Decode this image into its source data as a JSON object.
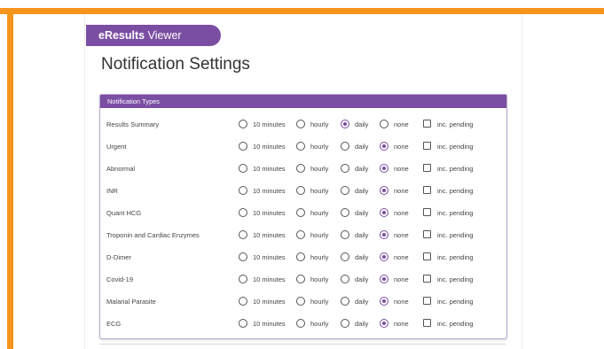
{
  "app": {
    "brand_bold": "eResults",
    "brand_rest": " Viewer"
  },
  "page": {
    "title": "Notification Settings"
  },
  "panel": {
    "header": "Notification Types"
  },
  "options": [
    "10 minutes",
    "hourly",
    "daily",
    "none"
  ],
  "pending_label": "inc. pending",
  "rows": [
    {
      "label": "Results Summary",
      "selected": "daily",
      "pending": false
    },
    {
      "label": "Urgent",
      "selected": "none",
      "pending": false
    },
    {
      "label": "Abnormal",
      "selected": "none",
      "pending": false
    },
    {
      "label": "INR",
      "selected": "none",
      "pending": false
    },
    {
      "label": "Quant HCG",
      "selected": "none",
      "pending": false
    },
    {
      "label": "Troponin and Cardiac Enzymes",
      "selected": "none",
      "pending": false
    },
    {
      "label": "D-Dimer",
      "selected": "none",
      "pending": false
    },
    {
      "label": "Covid-19",
      "selected": "none",
      "pending": false
    },
    {
      "label": "Malarial Parasite",
      "selected": "none",
      "pending": false
    },
    {
      "label": "ECG",
      "selected": "none",
      "pending": false
    }
  ],
  "colors": {
    "accent": "#7a4ea3",
    "frame": "#f7941d"
  }
}
